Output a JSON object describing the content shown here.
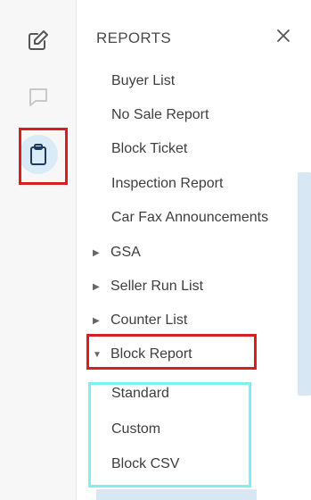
{
  "rail": {
    "icons": [
      "edit-icon",
      "chat-icon",
      "clipboard-icon"
    ],
    "active_color": "#d9ebf7"
  },
  "panel": {
    "title": "REPORTS",
    "close": "×"
  },
  "report_items": [
    "Buyer List",
    "No Sale Report",
    "Block Ticket",
    "Inspection Report",
    "Car Fax Announcements"
  ],
  "groups": [
    {
      "label": "GSA",
      "arrow": "▶"
    },
    {
      "label": "Seller Run List",
      "arrow": "▶"
    },
    {
      "label": "Counter List",
      "arrow": "▶"
    },
    {
      "label": "Block Report",
      "arrow": "▼"
    }
  ],
  "block_report_items": [
    "Standard",
    "Custom",
    "Block CSV"
  ],
  "colors": {
    "highlight_red": "#d81f1f",
    "highlight_cyan": "#7ff0f0",
    "scrollbar": "#d7e8f4"
  }
}
